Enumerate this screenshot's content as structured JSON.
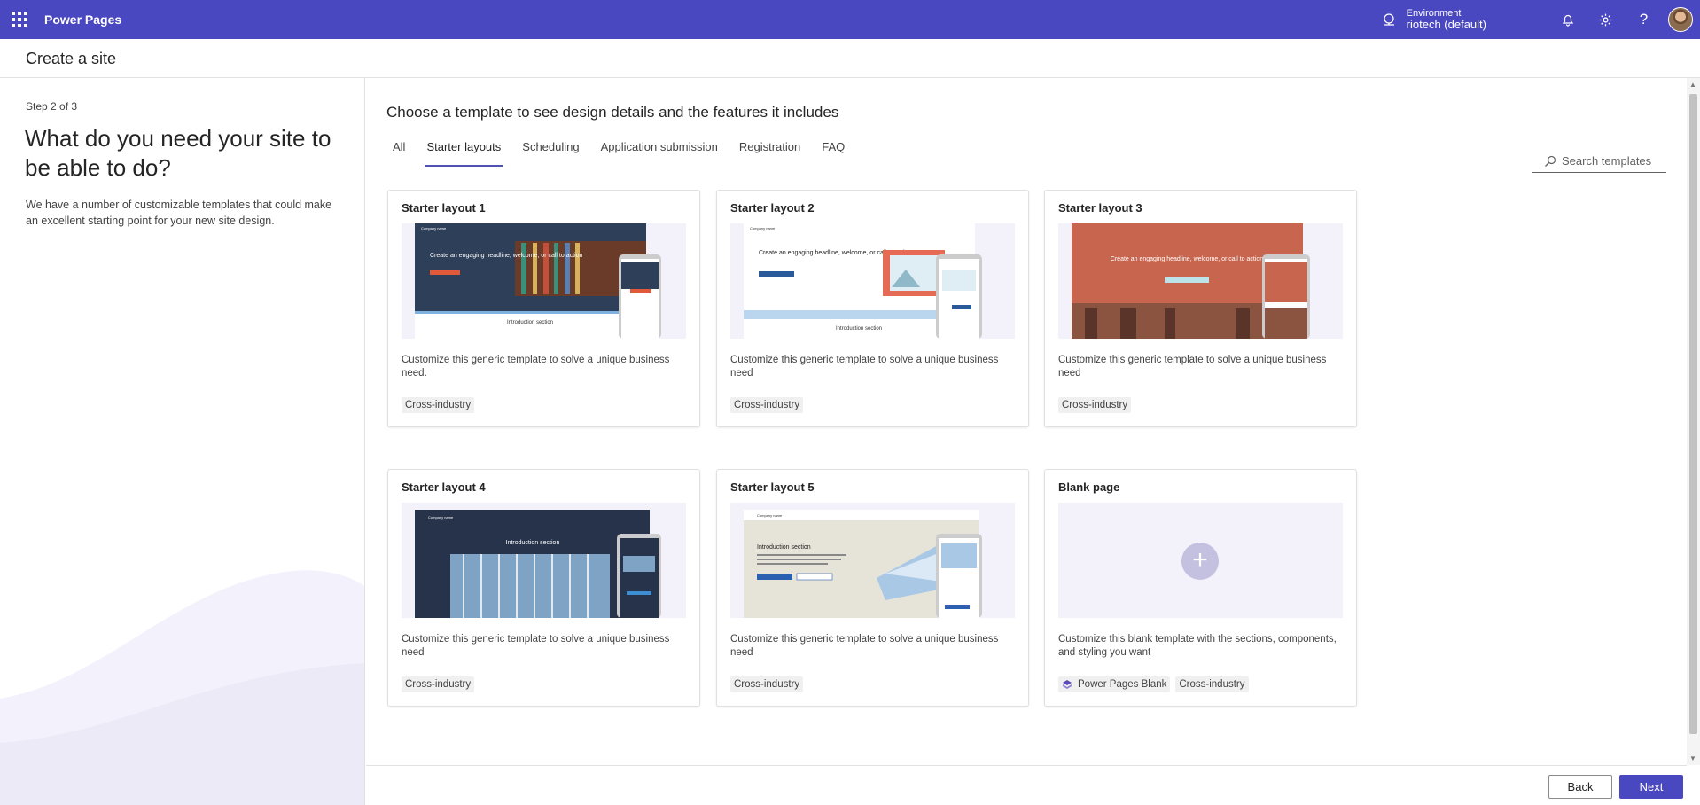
{
  "topbar": {
    "app_name": "Power Pages",
    "environment_label": "Environment",
    "environment_name": "riotech (default)",
    "icons": [
      "app-launcher-icon",
      "environment-icon",
      "bell-icon",
      "gear-icon",
      "help-icon",
      "avatar"
    ]
  },
  "page": {
    "title": "Create a site"
  },
  "left": {
    "step": "Step 2 of 3",
    "title": "What do you need your site to be able to do?",
    "description": "We have a number of customizable templates that could make an excellent starting point for your new site design."
  },
  "main": {
    "title": "Choose a template to see design details and the features it includes",
    "tabs": [
      {
        "label": "All"
      },
      {
        "label": "Starter layouts",
        "selected": true
      },
      {
        "label": "Scheduling"
      },
      {
        "label": "Application submission"
      },
      {
        "label": "Registration"
      },
      {
        "label": "FAQ"
      }
    ],
    "search_placeholder": "Search templates",
    "cards": [
      {
        "title": "Starter layout 1",
        "description": "Customize this generic template to solve a unique business need.",
        "tags": [
          "Cross-industry"
        ],
        "thumb_headline": "Create an engaging headline, welcome, or call to action",
        "thumb_section": "Introduction section",
        "thumb_company": "Company name"
      },
      {
        "title": "Starter layout 2",
        "description": "Customize this generic template to solve a unique business need",
        "tags": [
          "Cross-industry"
        ],
        "thumb_headline": "Create an engaging headline, welcome, or call to action",
        "thumb_section": "Introduction section",
        "thumb_company": "Company name"
      },
      {
        "title": "Starter layout 3",
        "description": "Customize this generic template to solve a unique business need",
        "tags": [
          "Cross-industry"
        ],
        "thumb_headline": "Create an engaging headline, welcome, or call to action",
        "thumb_section": "",
        "thumb_company": ""
      },
      {
        "title": "Starter layout 4",
        "description": "Customize this generic template to solve a unique business need",
        "tags": [
          "Cross-industry"
        ],
        "thumb_headline": "",
        "thumb_section": "Introduction section",
        "thumb_company": "Company name"
      },
      {
        "title": "Starter layout 5",
        "description": "Customize this generic template to solve a unique business need",
        "tags": [
          "Cross-industry"
        ],
        "thumb_headline": "",
        "thumb_section": "Introduction section",
        "thumb_company": "Company name"
      },
      {
        "title": "Blank page",
        "description": "Customize this blank template with the sections, components, and styling you want",
        "tags": [
          "Power Pages Blank",
          "Cross-industry"
        ],
        "thumb_headline": "",
        "thumb_section": "",
        "thumb_company": ""
      }
    ]
  },
  "footer": {
    "back": "Back",
    "next": "Next"
  },
  "colors": {
    "brand": "#4a48c0",
    "accent_tab": "#4f52b2",
    "layout3_hero": "#c8654f",
    "layout1_hero": "#2e3f5a"
  }
}
